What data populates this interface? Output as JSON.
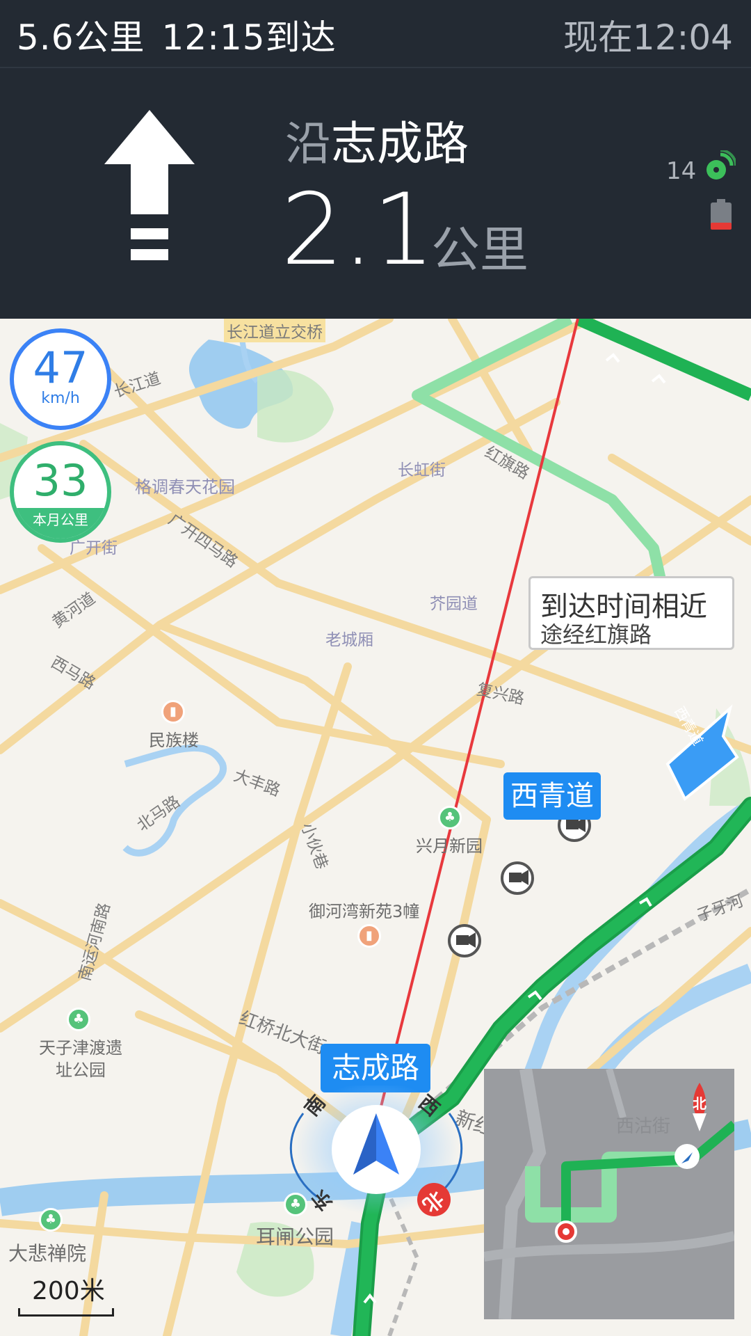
{
  "status_bar": {
    "remaining_distance": "5.6公里",
    "eta": "12:15到达",
    "current_time": "现在12:04"
  },
  "guidance": {
    "road_prefix": "沿",
    "road_name": "志成路",
    "distance_value": "2.1",
    "distance_unit": "公里",
    "satellite_count": "14",
    "turn_icon": "straight-arrow-icon",
    "gps_icon": "satellite-icon",
    "battery_icon": "battery-low-icon"
  },
  "speed": {
    "value": "47",
    "unit": "km/h"
  },
  "monthly_distance": {
    "value": "33",
    "unit": "本月公里"
  },
  "route_tags": {
    "next_road": "西青道",
    "current_road": "志成路"
  },
  "alternate_route": {
    "title": "到达时间相近",
    "via": "途经红旗路"
  },
  "map_labels": {
    "roads": [
      "长江道",
      "长江道立交桥",
      "长虹街",
      "红旗路",
      "芥园道",
      "广开四马路",
      "广开街",
      "黄河道",
      "西马路",
      "复兴路",
      "大丰路",
      "北马路",
      "小伙巷",
      "南运河南路",
      "红桥北大街",
      "新红桥",
      "子牙河",
      "西青道",
      "芥园道"
    ],
    "pois": [
      "格调春天花园",
      "民族楼",
      "兴月新园",
      "御河湾新苑3幢",
      "天子津渡遗址公园",
      "大悲禅院",
      "耳闸公园"
    ],
    "districts": [
      "老城厢",
      "长虹街"
    ]
  },
  "compass": {
    "north": "北",
    "south": "南",
    "east": "东",
    "west": "西"
  },
  "overview_map": {
    "label": "西沽街",
    "north": "北"
  },
  "scale": {
    "label": "200米"
  },
  "colors": {
    "route_green": "#1fb254",
    "route_light_green": "#8ee0a7",
    "straight_line_red": "#e8383d",
    "accent_blue": "#1e8cf2",
    "panel_dark": "#232a33"
  }
}
